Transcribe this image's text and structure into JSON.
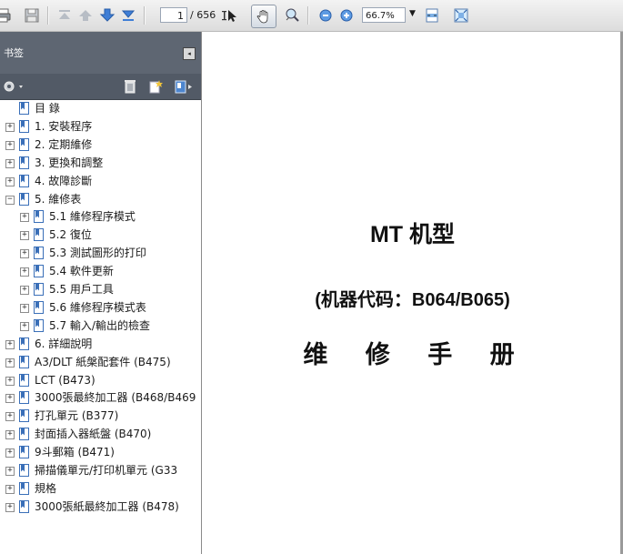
{
  "toolbar": {
    "page_current": "1",
    "page_total": "/ 656",
    "zoom": "66.7%",
    "icons": [
      "print-icon",
      "save-icon",
      "first-page-icon",
      "previous-page-icon",
      "next-page-icon",
      "last-page-icon",
      "select-tool-icon",
      "hand-tool-icon",
      "zoom-tool-icon",
      "zoom-out-icon",
      "zoom-in-icon",
      "fit-width-icon",
      "fit-page-icon"
    ]
  },
  "sidebar": {
    "title": "书签",
    "close_glyph": "◂",
    "tools": [
      "options-gear-icon",
      "delete-bookmark-icon",
      "new-bookmark-icon",
      "expand-bookmark-icon"
    ],
    "items": [
      {
        "label": "目  錄",
        "level": 0,
        "expander": ""
      },
      {
        "label": "1. 安裝程序",
        "level": 0,
        "expander": "+"
      },
      {
        "label": "2. 定期維修",
        "level": 0,
        "expander": "+"
      },
      {
        "label": "3. 更換和調整",
        "level": 0,
        "expander": "+"
      },
      {
        "label": "4. 故障診斷",
        "level": 0,
        "expander": "+"
      },
      {
        "label": "5. 維修表",
        "level": 0,
        "expander": "−"
      },
      {
        "label": "5.1 維修程序模式",
        "level": 1,
        "expander": "+"
      },
      {
        "label": "5.2 復位",
        "level": 1,
        "expander": "+"
      },
      {
        "label": "5.3 測試圖形的打印",
        "level": 1,
        "expander": "+"
      },
      {
        "label": "5.4 軟件更新",
        "level": 1,
        "expander": "+"
      },
      {
        "label": "5.5 用戶工具",
        "level": 1,
        "expander": "+"
      },
      {
        "label": "5.6 維修程序模式表",
        "level": 1,
        "expander": "+"
      },
      {
        "label": "5.7 輸入/輸出的檢查",
        "level": 1,
        "expander": "+"
      },
      {
        "label": "6. 詳細說明",
        "level": 0,
        "expander": "+"
      },
      {
        "label": "A3/DLT 紙槃配套件 (B475)",
        "level": 0,
        "expander": "+"
      },
      {
        "label": "LCT (B473)",
        "level": 0,
        "expander": "+"
      },
      {
        "label": "3000張最終加工器 (B468/B469",
        "level": 0,
        "expander": "+"
      },
      {
        "label": "打孔單元 (B377)",
        "level": 0,
        "expander": "+"
      },
      {
        "label": "封面插入器紙盤 (B470)",
        "level": 0,
        "expander": "+"
      },
      {
        "label": "9斗郵箱 (B471)",
        "level": 0,
        "expander": "+"
      },
      {
        "label": "掃描儀單元/打印机單元 (G33",
        "level": 0,
        "expander": "+"
      },
      {
        "label": "規格",
        "level": 0,
        "expander": "+"
      },
      {
        "label": "3000張紙最終加工器 (B478)",
        "level": 0,
        "expander": "+"
      }
    ]
  },
  "document": {
    "title": "MT 机型",
    "subtitle": "(机器代码：B064/B065)",
    "heading": "维 修 手 册"
  }
}
